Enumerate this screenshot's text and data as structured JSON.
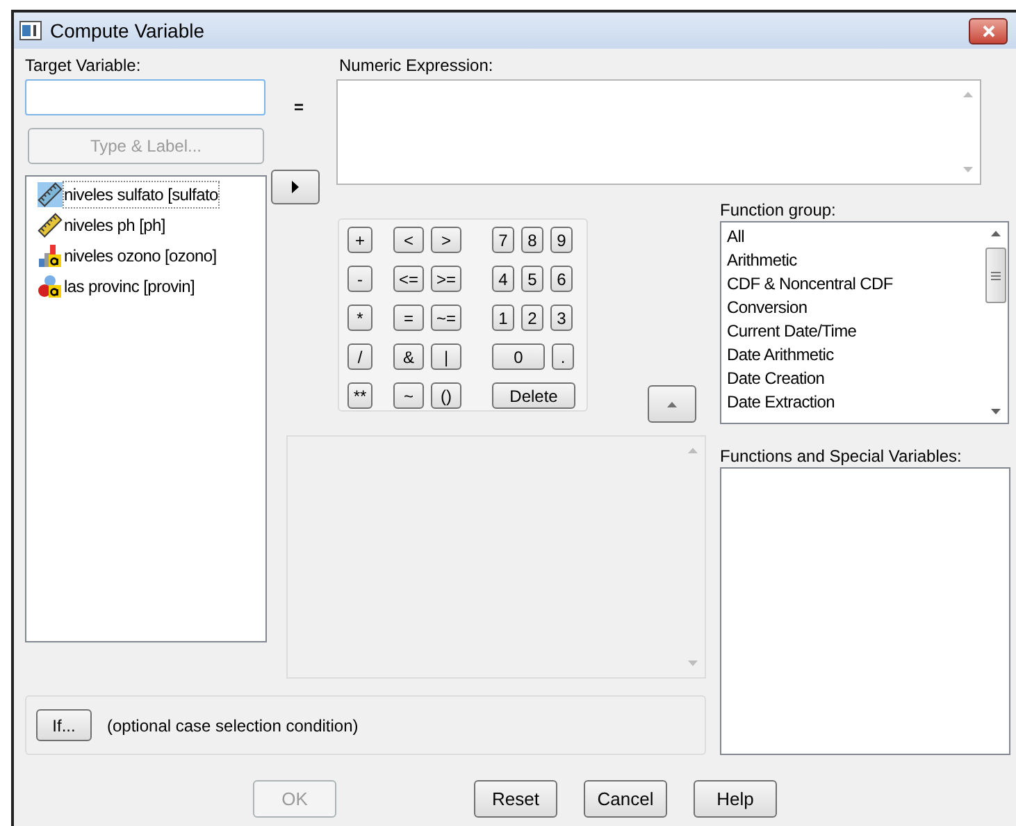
{
  "window": {
    "title": "Compute Variable"
  },
  "target_variable": {
    "label": "Target Variable:"
  },
  "type_label_button": {
    "label": "Type & Label...",
    "disabled": true
  },
  "equals_sign": "=",
  "numeric_expression": {
    "label": "Numeric Expression:"
  },
  "variables": [
    {
      "name": "niveles sulfato [sulfato",
      "kind": "scale",
      "selected": true
    },
    {
      "name": "niveles ph [ph]",
      "kind": "scale",
      "selected": false
    },
    {
      "name": "niveles ozono [ozono]",
      "kind": "ordinal",
      "selected": false
    },
    {
      "name": "las provinc [provin]",
      "kind": "nominal",
      "selected": false
    }
  ],
  "keypad": [
    [
      {
        "label": "+",
        "kind": "operator"
      },
      {
        "label": "<",
        "kind": "operator"
      },
      {
        "label": ">",
        "kind": "operator"
      },
      {
        "label": "7",
        "kind": "digit"
      },
      {
        "label": "8",
        "kind": "digit"
      },
      {
        "label": "9",
        "kind": "digit"
      }
    ],
    [
      {
        "label": "-",
        "kind": "operator"
      },
      {
        "label": "<=",
        "kind": "operator"
      },
      {
        "label": ">=",
        "kind": "operator"
      },
      {
        "label": "4",
        "kind": "digit"
      },
      {
        "label": "5",
        "kind": "digit"
      },
      {
        "label": "6",
        "kind": "digit"
      }
    ],
    [
      {
        "label": "*",
        "kind": "operator"
      },
      {
        "label": "=",
        "kind": "operator"
      },
      {
        "label": "~=",
        "kind": "operator"
      },
      {
        "label": "1",
        "kind": "digit"
      },
      {
        "label": "2",
        "kind": "digit"
      },
      {
        "label": "3",
        "kind": "digit"
      }
    ],
    [
      {
        "label": "/",
        "kind": "operator"
      },
      {
        "label": "&",
        "kind": "operator"
      },
      {
        "label": "|",
        "kind": "operator"
      },
      {
        "label": "0",
        "kind": "wide"
      },
      {
        "label": ".",
        "kind": "digit"
      }
    ],
    [
      {
        "label": "**",
        "kind": "operator"
      },
      {
        "label": "~",
        "kind": "operator"
      },
      {
        "label": "()",
        "kind": "operator"
      },
      {
        "label": "Delete",
        "kind": "action"
      }
    ]
  ],
  "function_group": {
    "label": "Function group:",
    "items": [
      "All",
      "Arithmetic",
      "CDF & Noncentral CDF",
      "Conversion",
      "Current Date/Time",
      "Date Arithmetic",
      "Date Creation",
      "Date Extraction"
    ]
  },
  "functions": {
    "label": "Functions and Special Variables:"
  },
  "if_condition": {
    "button": "If...",
    "text": "(optional case selection condition)"
  },
  "buttons": [
    {
      "label": "OK",
      "disabled": true
    },
    {
      "label": "Reset",
      "disabled": false
    },
    {
      "label": "Cancel",
      "disabled": false
    },
    {
      "label": "Help",
      "disabled": false
    }
  ]
}
